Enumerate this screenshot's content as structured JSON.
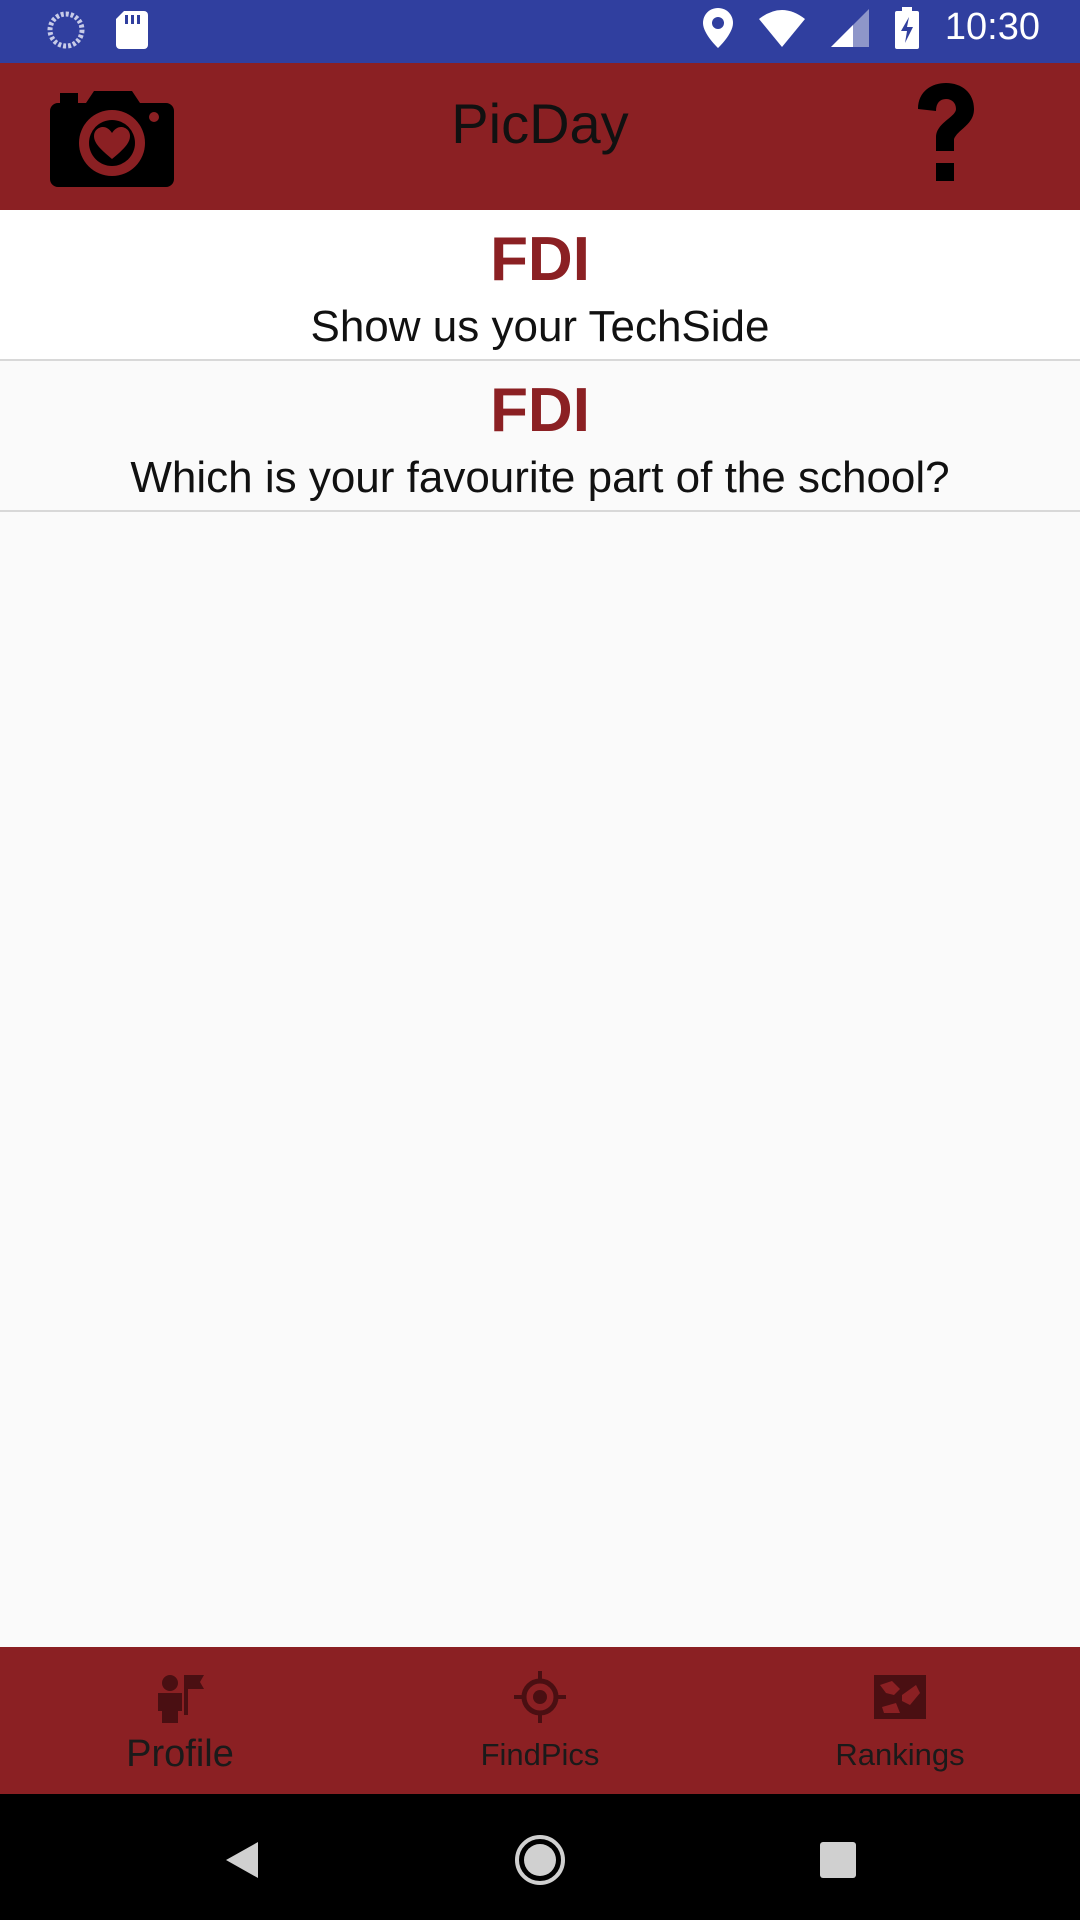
{
  "status_bar": {
    "time": "10:30",
    "icons": [
      "sync-icon",
      "sd-card-icon",
      "location-icon",
      "wifi-icon",
      "signal-icon",
      "battery-charging-icon"
    ]
  },
  "app_bar": {
    "title": "PicDay",
    "left_icon": "camera-heart-icon",
    "right_icon": "help-question-icon"
  },
  "challenges": [
    {
      "name": "FDI",
      "question": "Show us your TechSide"
    },
    {
      "name": "FDI",
      "question": "Which is your favourite part of the school?"
    }
  ],
  "bottom_nav": {
    "items": [
      {
        "label": "Profile",
        "icon": "profile-icon",
        "active": true
      },
      {
        "label": "FindPics",
        "icon": "crosshair-icon",
        "active": false
      },
      {
        "label": "Rankings",
        "icon": "rankings-image-icon",
        "active": false
      }
    ]
  },
  "system_nav": [
    "back-icon",
    "home-icon",
    "recents-icon"
  ],
  "colors": {
    "status_bar": "#303f9f",
    "primary": "#8b2023",
    "background": "#fafafa"
  }
}
